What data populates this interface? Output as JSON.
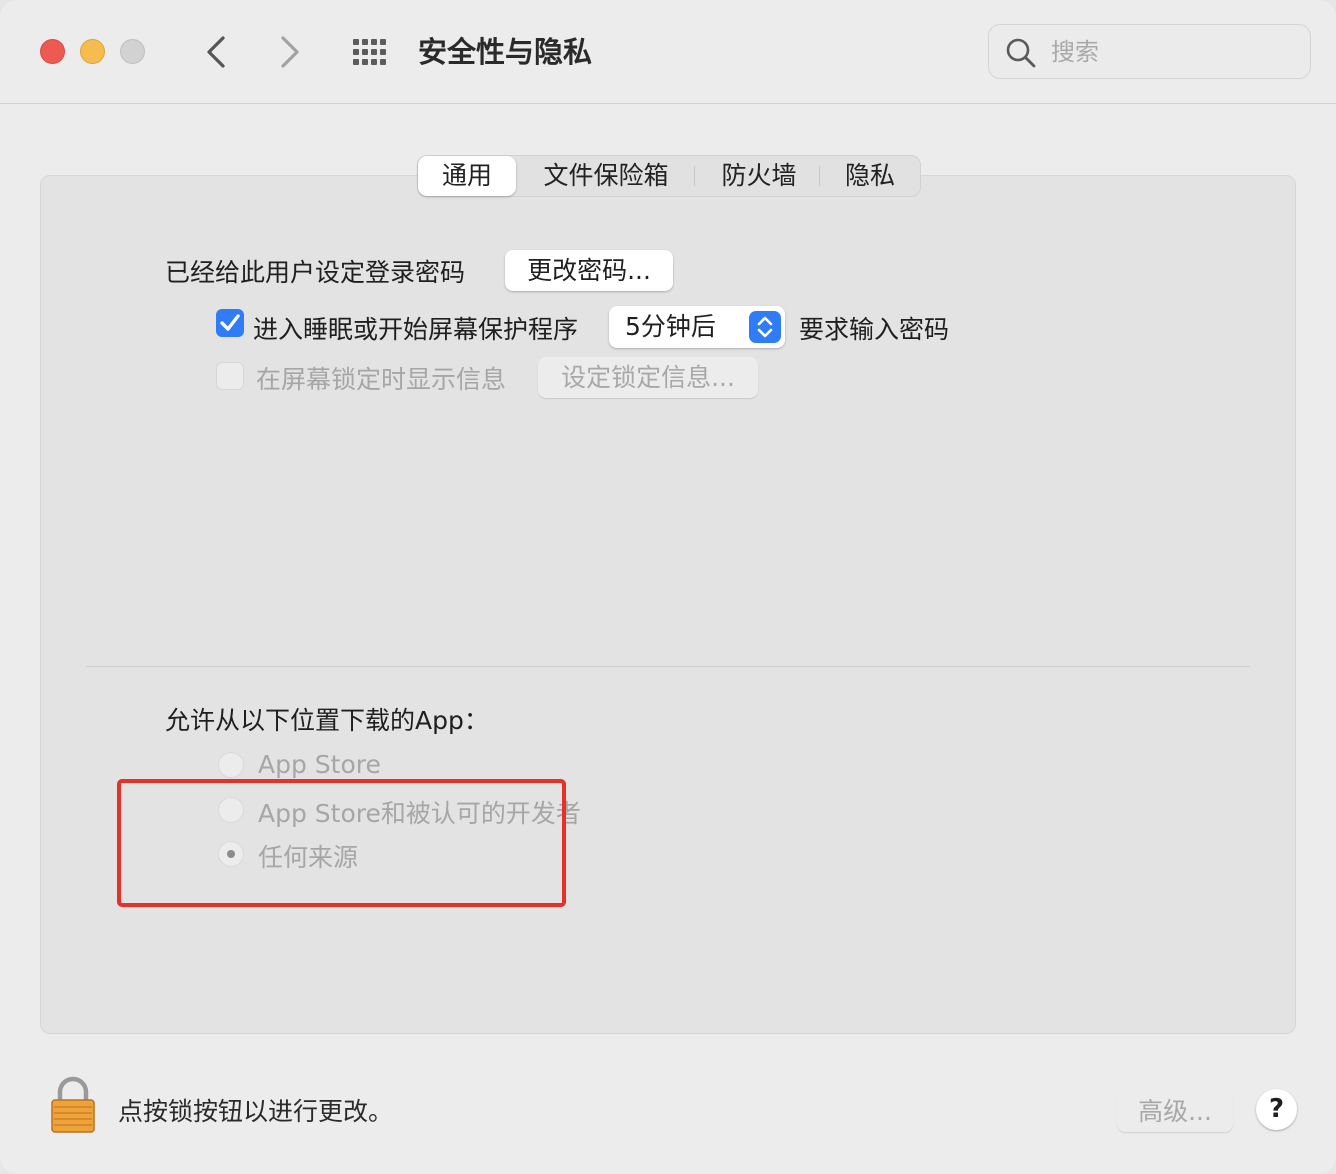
{
  "window": {
    "title": "安全性与隐私",
    "search_placeholder": "搜索"
  },
  "tabs": [
    {
      "label": "通用",
      "active": true
    },
    {
      "label": "文件保险箱",
      "active": false
    },
    {
      "label": "防火墙",
      "active": false
    },
    {
      "label": "隐私",
      "active": false
    }
  ],
  "general": {
    "password_set_label": "已经给此用户设定登录密码",
    "change_password_button": "更改密码...",
    "require_password": {
      "checked": true,
      "label_before": "进入睡眠或开始屏幕保护程序",
      "delay_value": "5分钟后",
      "label_after": "要求输入密码"
    },
    "lock_message": {
      "checked": false,
      "label": "在屏幕锁定时显示信息",
      "button": "设定锁定信息..."
    }
  },
  "downloads": {
    "heading": "允许从以下位置下载的App：",
    "options": [
      {
        "label": "App Store",
        "selected": false
      },
      {
        "label": "App Store和被认可的开发者",
        "selected": false
      },
      {
        "label": "任何来源",
        "selected": true
      }
    ]
  },
  "footer": {
    "lock_label": "点按锁按钮以进行更改。",
    "advanced_button": "高级...",
    "help_button": "?"
  },
  "colors": {
    "accent": "#2f7cf6",
    "highlight_box": "#e4322b"
  }
}
